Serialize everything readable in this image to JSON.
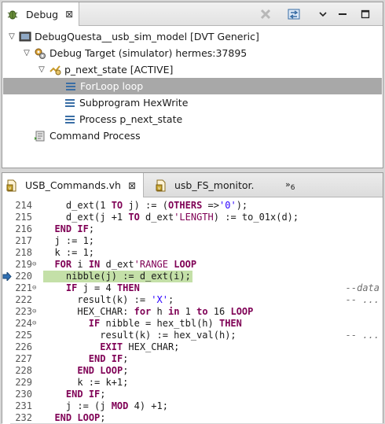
{
  "debug_view": {
    "tab_label": "Debug",
    "tab_close": "⊠",
    "tree": [
      {
        "depth": 0,
        "twisty": "▽",
        "icon": "questa-launch-icon",
        "label": "DebugQuesta__usb_sim_model [DVT Generic]"
      },
      {
        "depth": 1,
        "twisty": "▽",
        "icon": "debug-target-icon",
        "label": "Debug Target (simulator) hermes:37895"
      },
      {
        "depth": 2,
        "twisty": "▽",
        "icon": "process-thread-icon",
        "label": "p_next_state [ACTIVE]"
      },
      {
        "depth": 3,
        "twisty": "",
        "icon": "stack-frame-icon",
        "label": "ForLoop loop",
        "selected": true
      },
      {
        "depth": 3,
        "twisty": "",
        "icon": "stack-frame-icon",
        "label": "Subprogram HexWrite"
      },
      {
        "depth": 3,
        "twisty": "",
        "icon": "stack-frame-icon",
        "label": "Process p_next_state"
      },
      {
        "depth": 1,
        "twisty": "",
        "icon": "command-process-icon",
        "label": "Command Process"
      }
    ]
  },
  "editor": {
    "tabs": [
      {
        "label": "USB_Commands.vh",
        "close": "⊠",
        "active": true
      },
      {
        "label": "usb_FS_monitor.",
        "close": "",
        "active": false
      }
    ],
    "more_tabs_glyph": "»",
    "more_tabs_count": "6",
    "current_line": 220,
    "lines": [
      {
        "n": "214",
        "fold": "",
        "code": "    d_ext(1 TO j) := (OTHERS =>'0');"
      },
      {
        "n": "215",
        "fold": "",
        "code": "    d_ext(j +1 TO d_ext'LENGTH) := to_01x(d);"
      },
      {
        "n": "216",
        "fold": "",
        "code": "  END IF;"
      },
      {
        "n": "217",
        "fold": "",
        "code": "  j := 1;"
      },
      {
        "n": "218",
        "fold": "",
        "code": "  k := 1;"
      },
      {
        "n": "219",
        "fold": "⊖",
        "code": "  FOR i IN d_ext'RANGE LOOP"
      },
      {
        "n": "220",
        "fold": "",
        "code": "    nibble(j) := d_ext(i);"
      },
      {
        "n": "221",
        "fold": "⊖",
        "code": "    IF j = 4 THEN",
        "comment": "--data"
      },
      {
        "n": "222",
        "fold": "",
        "code": "      result(k) := 'X';",
        "comment": "-- ..."
      },
      {
        "n": "223",
        "fold": "⊖",
        "code": "      HEX_CHAR: for h in 1 to 16 LOOP"
      },
      {
        "n": "224",
        "fold": "⊖",
        "code": "        IF nibble = hex_tbl(h) THEN"
      },
      {
        "n": "225",
        "fold": "",
        "code": "          result(k) := hex_val(h);",
        "comment": "-- ..."
      },
      {
        "n": "226",
        "fold": "",
        "code": "          EXIT HEX_CHAR;"
      },
      {
        "n": "227",
        "fold": "",
        "code": "        END IF;"
      },
      {
        "n": "228",
        "fold": "",
        "code": "      END LOOP;"
      },
      {
        "n": "229",
        "fold": "",
        "code": "      k := k+1;"
      },
      {
        "n": "230",
        "fold": "",
        "code": "    END IF;"
      },
      {
        "n": "231",
        "fold": "",
        "code": "    j := (j MOD 4) +1;"
      },
      {
        "n": "232",
        "fold": "",
        "code": "  END LOOP;"
      }
    ],
    "keywords": [
      "TO",
      "OTHERS",
      "END",
      "IF",
      "FOR",
      "IN",
      "LOOP",
      "THEN",
      "for",
      "in",
      "to",
      "EXIT",
      "MOD"
    ],
    "colors": {
      "keyword": "#7f0055",
      "string": "#2a00ff",
      "current_line": "#c4e0a8",
      "selection": "#a8a8a8"
    }
  }
}
